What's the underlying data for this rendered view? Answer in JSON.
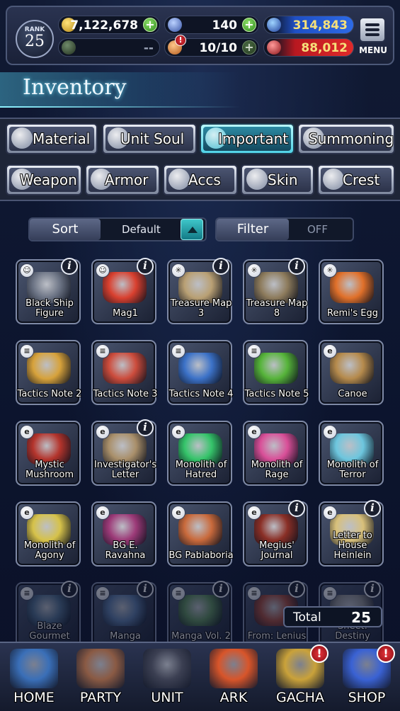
{
  "status": {
    "rank_label": "RANK",
    "rank_value": "25",
    "gil": "7,122,678",
    "visiore": "140",
    "blue_currency": "314,843",
    "ally_text": "--",
    "energy": "10/10",
    "red_currency": "88,012",
    "menu_label": "MENU"
  },
  "header": {
    "title": "Inventory"
  },
  "tabs_row1": [
    {
      "label": "Material",
      "icon": "sack-icon"
    },
    {
      "label": "Unit Soul",
      "icon": "soul-flame-icon"
    },
    {
      "label": "Important",
      "icon": "star-icon",
      "active": true
    },
    {
      "label": "Summoning",
      "icon": "summon-icon"
    }
  ],
  "tabs_row2": [
    {
      "label": "Weapon",
      "icon": "sword-icon"
    },
    {
      "label": "Armor",
      "icon": "armor-icon"
    },
    {
      "label": "Accs",
      "icon": "ring-icon"
    },
    {
      "label": "Skin",
      "icon": "hanger-icon"
    },
    {
      "label": "Crest",
      "icon": "crest-icon"
    }
  ],
  "controls": {
    "sort_label": "Sort",
    "sort_value": "Default",
    "filter_label": "Filter",
    "filter_value": "OFF"
  },
  "items": [
    {
      "name": "Black Ship Figure",
      "badge": "smiley",
      "info": true,
      "color": "#6b7384"
    },
    {
      "name": "Mag1",
      "badge": "smiley",
      "info": true,
      "color": "#d9402f"
    },
    {
      "name": "Treasure Map 3",
      "badge": "compass",
      "info": true,
      "color": "#b9a074"
    },
    {
      "name": "Treasure Map 8",
      "badge": "compass",
      "info": true,
      "color": "#8d7b5c"
    },
    {
      "name": "Remi's Egg",
      "badge": "compass",
      "info": false,
      "color": "#e0702a"
    },
    {
      "name": "Tactics Note 2",
      "badge": "note",
      "info": false,
      "color": "#d7a23b"
    },
    {
      "name": "Tactics Note 3",
      "badge": "note",
      "info": false,
      "color": "#cc4c3c"
    },
    {
      "name": "Tactics Note 4",
      "badge": "note",
      "info": false,
      "color": "#3c72c8"
    },
    {
      "name": "Tactics Note 5",
      "badge": "note",
      "info": false,
      "color": "#56b43a"
    },
    {
      "name": "Canoe",
      "badge": "etc",
      "info": false,
      "color": "#b58a4c"
    },
    {
      "name": "Mystic Mushroom",
      "badge": "etc",
      "info": false,
      "color": "#b4342c"
    },
    {
      "name": "Investigator's Letter",
      "badge": "etc",
      "info": true,
      "color": "#a98f6a"
    },
    {
      "name": "Monolith of Hatred",
      "badge": "etc",
      "info": false,
      "color": "#35c46a"
    },
    {
      "name": "Monolith of Rage",
      "badge": "etc",
      "info": false,
      "color": "#d94f98"
    },
    {
      "name": "Monolith of Terror",
      "badge": "etc",
      "info": false,
      "color": "#6dc6de"
    },
    {
      "name": "Monolith of Agony",
      "badge": "etc",
      "info": false,
      "color": "#d6c24a"
    },
    {
      "name": "BG E. Ravahna",
      "badge": "etc",
      "info": false,
      "color": "#9c3a78"
    },
    {
      "name": "BG Pablaboria",
      "badge": "etc",
      "info": false,
      "color": "#c96a3c"
    },
    {
      "name": "Megius' Journal",
      "badge": "etc",
      "info": true,
      "color": "#8a2f26"
    },
    {
      "name": "Letter to House Heinlein",
      "badge": "etc",
      "info": true,
      "color": "#d8c07a"
    },
    {
      "name": "Blaze Gourmet",
      "badge": "note",
      "info": true,
      "color": "#4f6d8c"
    },
    {
      "name": "Manga",
      "badge": "note",
      "info": true,
      "color": "#5b7aa6"
    },
    {
      "name": "Manga Vol. 2",
      "badge": "note",
      "info": true,
      "color": "#5c8d5a"
    },
    {
      "name": "From: Lenius",
      "badge": "note",
      "info": true,
      "color": "#a3493a"
    },
    {
      "name": "Sheet: Destiny",
      "badge": "note",
      "info": true,
      "color": "#8e8e8e"
    }
  ],
  "total": {
    "label": "Total",
    "value": "25"
  },
  "nav": [
    {
      "label": "HOME",
      "color": "#3a6fb8",
      "alert": false
    },
    {
      "label": "PARTY",
      "color": "#8a5a44",
      "alert": false
    },
    {
      "label": "UNIT",
      "color": "#3b3f52",
      "alert": false
    },
    {
      "label": "ARK",
      "color": "#d8552a",
      "alert": false
    },
    {
      "label": "GACHA",
      "color": "#caa23a",
      "alert": true,
      "alert_text": "!"
    },
    {
      "label": "SHOP",
      "color": "#3a62d4",
      "alert": true,
      "alert_text": "!"
    }
  ],
  "colors": {
    "accent": "#3fd0e4",
    "panel": "#1e2537",
    "frame": "#7e89a5"
  }
}
